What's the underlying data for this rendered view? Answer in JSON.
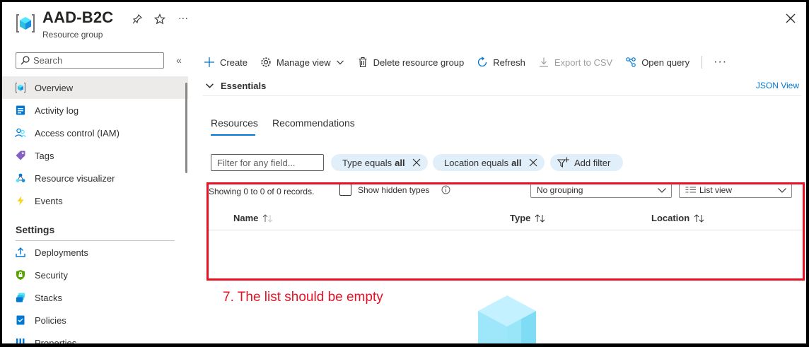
{
  "header": {
    "title": "AAD-B2C",
    "subtitle": "Resource group"
  },
  "sidebar": {
    "search_placeholder": "Search",
    "items": [
      {
        "label": "Overview",
        "icon": "resource-group-icon",
        "active": true
      },
      {
        "label": "Activity log",
        "icon": "activity-log-icon"
      },
      {
        "label": "Access control (IAM)",
        "icon": "people-icon"
      },
      {
        "label": "Tags",
        "icon": "tag-icon"
      },
      {
        "label": "Resource visualizer",
        "icon": "visualizer-icon"
      },
      {
        "label": "Events",
        "icon": "lightning-icon"
      }
    ],
    "settings_header": "Settings",
    "settings_items": [
      {
        "label": "Deployments",
        "icon": "upload-icon"
      },
      {
        "label": "Security",
        "icon": "shield-icon"
      },
      {
        "label": "Stacks",
        "icon": "stacks-icon"
      },
      {
        "label": "Policies",
        "icon": "policy-icon"
      },
      {
        "label": "Properties",
        "icon": "properties-icon"
      }
    ]
  },
  "toolbar": {
    "create": "Create",
    "manage_view": "Manage view",
    "delete": "Delete resource group",
    "refresh": "Refresh",
    "export": "Export to CSV",
    "open_query": "Open query",
    "more": "···"
  },
  "essentials": {
    "label": "Essentials",
    "json_view": "JSON View"
  },
  "tabs": {
    "resources": "Resources",
    "recommendations": "Recommendations"
  },
  "filters": {
    "placeholder": "Filter for any field...",
    "type_pill_prefix": "Type equals",
    "type_pill_value": "all",
    "location_pill_prefix": "Location equals",
    "location_pill_value": "all",
    "add_filter": "Add filter"
  },
  "list": {
    "records": "Showing 0 to 0 of 0 records.",
    "show_hidden": "Show hidden types",
    "grouping": "No grouping",
    "view": "List view",
    "columns": [
      "Name",
      "Type",
      "Location"
    ]
  },
  "annotation": "7. The list should be empty",
  "colors": {
    "accent": "#0078d4",
    "annotation": "#e81123",
    "pill": "#e1effa"
  }
}
